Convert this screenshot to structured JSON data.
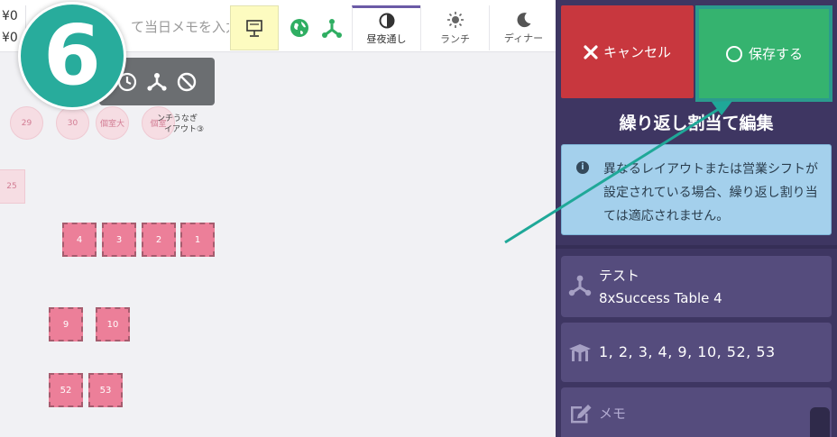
{
  "toolbar": {
    "yen_top": "¥0",
    "yen_bottom": "¥0",
    "memo_placeholder": "て当日メモを入力",
    "icons": [
      "presentation-icon",
      "globe-icon",
      "layout-icon"
    ],
    "modes": [
      {
        "label": "昼夜通し",
        "icon": "half-moon-icon",
        "active": true
      },
      {
        "label": "ランチ",
        "icon": "sun-icon",
        "active": false
      },
      {
        "label": "ディナー",
        "icon": "moon-icon",
        "active": false
      }
    ]
  },
  "step_badge": "6",
  "floor": {
    "round_tables": [
      "29",
      "30",
      "個室大",
      "個室"
    ],
    "room_label_1": "ンチうなぎ",
    "room_label_2": "イアウト③",
    "edge_table": "25",
    "tables": [
      "4",
      "3",
      "2",
      "1",
      "9",
      "10",
      "52",
      "53"
    ]
  },
  "panel": {
    "cancel_label": "キャンセル",
    "save_label": "保存する",
    "title": "繰り返し割当て編集",
    "info_text": "異なるレイアウトまたは営業シフトが設定されている場合、繰り返し割り当ては適応されません。",
    "layout_name": "テスト",
    "layout_sub": "8xSuccess Table 4",
    "tables_list": "1, 2, 3, 4, 9, 10, 52, 53",
    "memo_label": "メモ"
  },
  "colors": {
    "panel_bg": "#3e3662",
    "cancel": "#c8373e",
    "save": "#35b36f",
    "badge": "#28ac9c",
    "arrow": "#1fa898",
    "table": "#ec7f99"
  }
}
